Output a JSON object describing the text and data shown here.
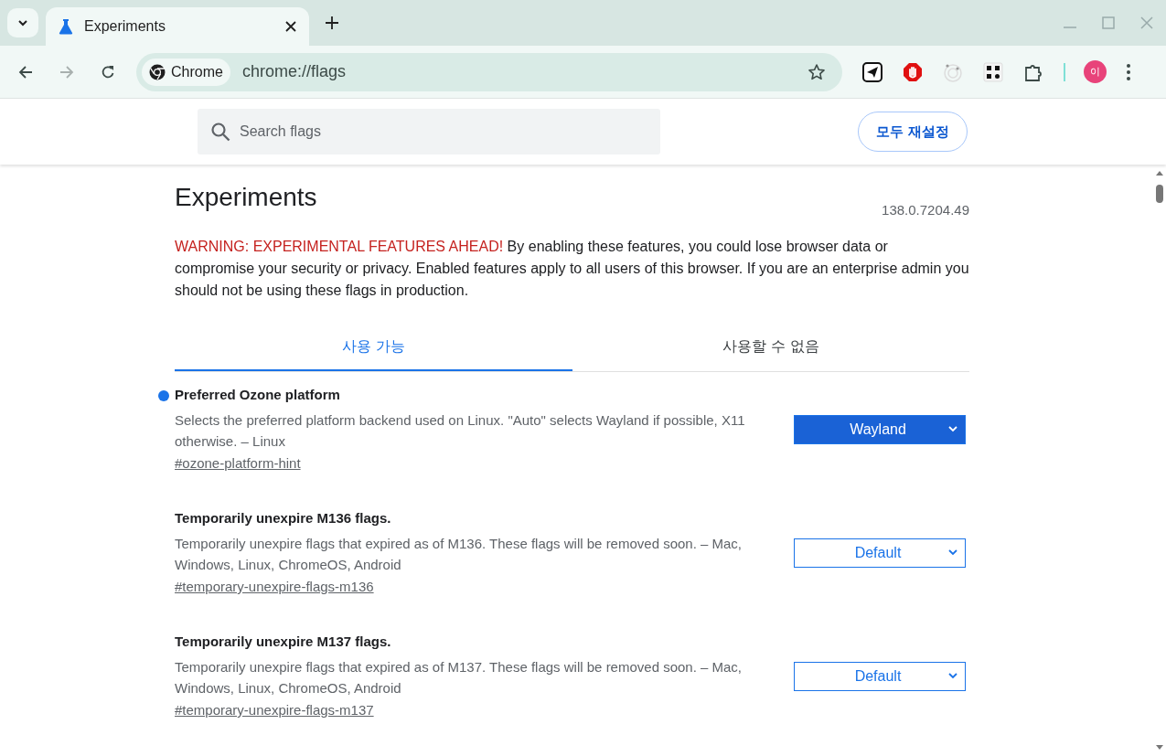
{
  "browser": {
    "tab": {
      "title": "Experiments"
    },
    "omnibox": {
      "chip": "Chrome",
      "url": "chrome://flags"
    },
    "avatar": "이"
  },
  "header": {
    "search": {
      "placeholder": "Search flags"
    },
    "reset_button": "모두 재설정"
  },
  "page": {
    "title": "Experiments",
    "version": "138.0.7204.49",
    "warning_label": "WARNING: EXPERIMENTAL FEATURES AHEAD!",
    "warning_text": "By enabling these features, you could lose browser data or compromise your security or privacy. Enabled features apply to all users of this browser. If you are an enterprise admin you should not be using these flags in production.",
    "tabs": [
      {
        "label": "사용 가능",
        "selected": true
      },
      {
        "label": "사용할 수 없음",
        "selected": false
      }
    ],
    "flags": [
      {
        "title": "Preferred Ozone platform",
        "description": "Selects the preferred platform backend used on Linux. \"Auto\" selects Wayland if possible, X11 otherwise. – Linux",
        "link": "#ozone-platform-hint",
        "value": "Wayland",
        "modified": true
      },
      {
        "title": "Temporarily unexpire M136 flags.",
        "description": "Temporarily unexpire flags that expired as of M136. These flags will be removed soon. – Mac, Windows, Linux, ChromeOS, Android",
        "link": "#temporary-unexpire-flags-m136",
        "value": "Default",
        "modified": false
      },
      {
        "title": "Temporarily unexpire M137 flags.",
        "description": "Temporarily unexpire flags that expired as of M137. These flags will be removed soon. – Mac, Windows, Linux, ChromeOS, Android",
        "link": "#temporary-unexpire-flags-m137",
        "value": "Default",
        "modified": false
      }
    ]
  }
}
